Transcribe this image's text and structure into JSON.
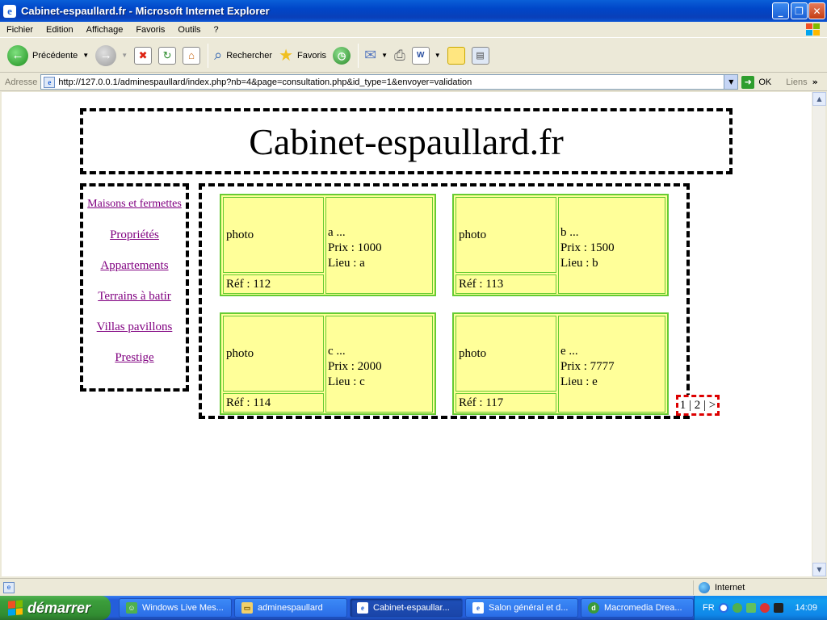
{
  "window": {
    "title": "Cabinet-espaullard.fr - Microsoft Internet Explorer",
    "buttons": {
      "minimize": "_",
      "maximize": "❐",
      "close": "✕"
    }
  },
  "menu": [
    "Fichier",
    "Edition",
    "Affichage",
    "Favoris",
    "Outils",
    "?"
  ],
  "toolbar": {
    "back_label": "Précédente",
    "search_label": "Rechercher",
    "favorites_label": "Favoris"
  },
  "address": {
    "label": "Adresse",
    "url": "http://127.0.0.1/adminespaullard/index.php?nb=4&page=consultation.php&id_type=1&envoyer=validation",
    "go_label": "OK",
    "links_label": "Liens"
  },
  "page": {
    "site_title": "Cabinet-espaullard.fr",
    "nav": [
      "Maisons et fermettes",
      "Propriétés",
      "Appartements",
      "Terrains à batir",
      "Villas pavillons",
      "Prestige"
    ],
    "listings": [
      {
        "photo": "photo",
        "ref": "Réf : 112",
        "name": "a ...",
        "price": "Prix : 1000",
        "place": "Lieu : a"
      },
      {
        "photo": "photo",
        "ref": "Réf : 113",
        "name": "b ...",
        "price": "Prix : 1500",
        "place": "Lieu : b"
      },
      {
        "photo": "photo",
        "ref": "Réf : 114",
        "name": "c ...",
        "price": "Prix : 2000",
        "place": "Lieu : c"
      },
      {
        "photo": "photo",
        "ref": "Réf : 117",
        "name": "e ...",
        "price": "Prix : 7777",
        "place": "Lieu : e"
      }
    ],
    "pager": "1 | 2 | >"
  },
  "status": {
    "zone": "Internet"
  },
  "taskbar": {
    "start_label": "démarrer",
    "tasks": [
      {
        "label": "Windows Live Mes...",
        "active": false
      },
      {
        "label": "adminespaullard",
        "active": false
      },
      {
        "label": "Cabinet-espaullar...",
        "active": true
      },
      {
        "label": "Salon général et d...",
        "active": false
      },
      {
        "label": "Macromedia Drea...",
        "active": false
      }
    ],
    "language": "FR",
    "clock": "14:09"
  },
  "colors": {
    "card_fill": "#ffff99",
    "card_border": "#66cc33",
    "link": "#800080",
    "pager_border": "#dd0000"
  }
}
